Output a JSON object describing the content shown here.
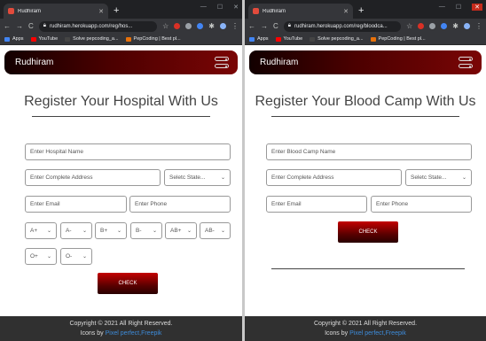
{
  "left": {
    "tab_title": "Rudhiram",
    "url": "rudhiram.herokuapp.com/reg/hos...",
    "bookmarks": {
      "apps": "Apps",
      "youtube": "YouTube",
      "pepcoding_a": "Solve pepcoding_a...",
      "pepcoding_best": "PepCoding | Best pl..."
    },
    "brand": "Rudhiram",
    "title": "Register Your Hospital With Us",
    "fields": {
      "hospital_name": "Enter Hospital Name",
      "address": "Enter Complete Address",
      "state": "Seletc State...",
      "email": "Enter Email",
      "phone": "Enter Phone"
    },
    "blood_groups": [
      "A+",
      "A-",
      "B+",
      "B-",
      "AB+",
      "AB-",
      "O+",
      "O-"
    ],
    "check": "CHECK",
    "footer": {
      "copyright": "Copyright © 2021 All Right Reserved.",
      "icons_by": "Icons by",
      "icons_link": "Pixel perfect,Freepik"
    }
  },
  "right": {
    "tab_title": "Rudhiram",
    "url": "rudhiram.herokuapp.com/reg/bloodca...",
    "bookmarks": {
      "apps": "Apps",
      "youtube": "YouTube",
      "pepcoding_a": "Solve pepcoding_a...",
      "pepcoding_best": "PepCoding | Best pl..."
    },
    "brand": "Rudhiram",
    "title": "Register Your Blood Camp With Us",
    "fields": {
      "camp_name": "Enter Blood Camp Name",
      "address": "Enter Complete Address",
      "state": "Seletc State...",
      "email": "Enter Email",
      "phone": "Enter Phone"
    },
    "check": "CHECK",
    "footer": {
      "copyright": "Copyright © 2021 All Right Reserved.",
      "icons_by": "Icons by",
      "icons_link": "Pixel perfect,Freepik"
    }
  },
  "colors": {
    "navbar_dark": "#120000",
    "navbar_red": "#7a0505",
    "button_red": "#c40000",
    "footer_bg": "#303030",
    "link_blue": "#3d8bd9"
  },
  "icons": {
    "favicon": "blood-drop-icon",
    "toggler": "toggle-switch-icon"
  }
}
